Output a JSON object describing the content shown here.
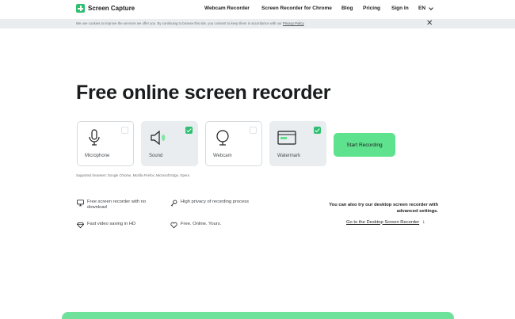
{
  "header": {
    "logo_text": "Screen Capture",
    "nav": [
      {
        "label": "Webcam Recorder"
      },
      {
        "label": "Screen Recorder for Chrome"
      },
      {
        "label": "Blog"
      },
      {
        "label": "Pricing"
      },
      {
        "label": "Sign In"
      }
    ],
    "language": "EN"
  },
  "cookie": {
    "text": "We use cookies to improve the services we offer you. By continuing to browse this site, you consent to keep them in accordance with our",
    "link": "Privacy Policy",
    "close": "✕"
  },
  "title": "Free online screen recorder",
  "options": [
    {
      "label": "Microphone",
      "checked": false,
      "icon": "microphone-icon"
    },
    {
      "label": "Sound",
      "checked": true,
      "icon": "speaker-icon"
    },
    {
      "label": "Webcam",
      "checked": false,
      "icon": "webcam-icon"
    },
    {
      "label": "Watermark",
      "checked": true,
      "icon": "watermark-icon"
    }
  ],
  "start_button": "Start Recording",
  "supported_browsers": "Supported browsers: Google Chrome, Mozilla Firefox, Microsoft Edge, Opera",
  "features": [
    {
      "text": "Free screen recorder with no download",
      "icon": "monitor-icon"
    },
    {
      "text": "High privacy of recording process",
      "icon": "key-icon"
    },
    {
      "text": "Fast video saving in HD",
      "icon": "diamond-icon"
    },
    {
      "text": "Free. Online. Yours.",
      "icon": "heart-icon"
    }
  ],
  "desktop": {
    "text": "You can also try our desktop screen recorder with advanced settings.",
    "link": "Go to the Desktop Screen Recorder",
    "arrow": "↓"
  },
  "colors": {
    "accent": "#2fbf71",
    "button": "#5fe28e",
    "cookie_bg": "#e9edf0",
    "card_active": "#e9edef"
  }
}
